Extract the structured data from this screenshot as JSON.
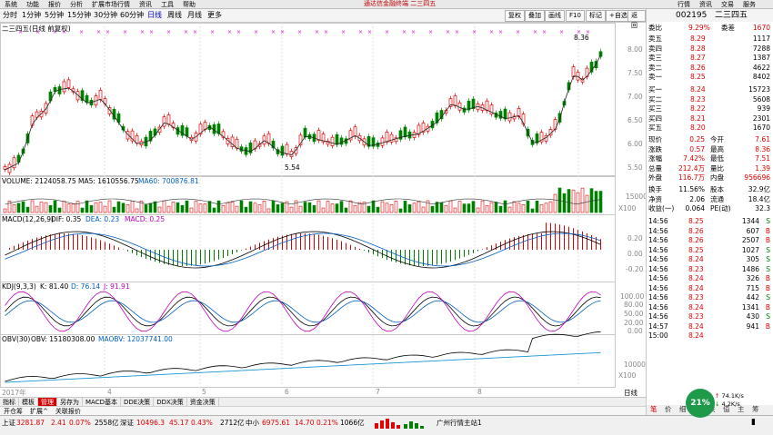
{
  "menu": {
    "left": [
      "系统",
      "功能",
      "报价",
      "分析",
      "扩展市场行情",
      "资讯",
      "工具",
      "帮助"
    ],
    "title": "通达信金融终端 二三四五",
    "right": [
      "行情",
      "资讯",
      "交易",
      "服务"
    ]
  },
  "period_tabs": [
    "分时",
    "1分钟",
    "5分钟",
    "15分钟",
    "30分钟",
    "60分钟",
    "日线",
    "周线",
    "月线",
    "更多"
  ],
  "active_period": "日线",
  "right_buttons": [
    "复权",
    "叠加",
    "画线",
    "F10",
    "标记",
    "+自选",
    "返回"
  ],
  "chart_title": "二三四五(日线 前复权)",
  "price_axis": [
    "8.00",
    "7.50",
    "7.00",
    "6.50",
    "6.00",
    "5.50"
  ],
  "annotations": {
    "high": "8.36",
    "low": "5.54"
  },
  "volume": {
    "label": "VOLUME: 2124058.75",
    "ma5": "MA5: 1610556.75",
    "ma60": "MA60: 700876.81",
    "axis": "15000",
    "unit": "X100"
  },
  "macd": {
    "label": "MACD(12,26,9)",
    "dif": "DIF: 0.35",
    "dea": "DEA: 0.23",
    "macd": "MACD: 0.25",
    "axis": [
      "0.20",
      "0.00",
      "-0.20"
    ]
  },
  "kdj": {
    "label": "KDJ(9,3,3)",
    "k": "K: 81.40",
    "d": "D: 76.14",
    "j": "J: 91.91",
    "axis": [
      "100.00",
      "80.00",
      "50.00",
      "20.00",
      "0.00"
    ]
  },
  "obv": {
    "label": "OBV(30)",
    "obv": "OBV: 15180308.00",
    "maobv": "MAOBV: 12037741.00",
    "axis": "10000",
    "unit": "X100"
  },
  "x_axis": [
    "2017年",
    "4",
    "5",
    "6",
    "7",
    "8"
  ],
  "bottom_tabs": [
    "指标",
    "模板",
    "管理",
    "另存为",
    "MACD基本",
    "DDE决策",
    "DDX决策",
    "资金决策"
  ],
  "bottom_tabs_active": "管理",
  "bottom_tabs2": [
    "开仓筹",
    "扩展^",
    "关联报价"
  ],
  "chart_right_tag": "日线",
  "stock": {
    "code": "002195",
    "name": "二三四五"
  },
  "weibi": {
    "label": "委比",
    "pct": "9.29%",
    "diff_label": "委差",
    "diff": "1670"
  },
  "asks": [
    {
      "label": "卖五",
      "price": "8.29",
      "vol": "1117"
    },
    {
      "label": "卖四",
      "price": "8.28",
      "vol": "7288"
    },
    {
      "label": "卖三",
      "price": "8.27",
      "vol": "1387"
    },
    {
      "label": "卖二",
      "price": "8.26",
      "vol": "4622"
    },
    {
      "label": "卖一",
      "price": "8.25",
      "vol": "8402"
    }
  ],
  "bids": [
    {
      "label": "买一",
      "price": "8.24",
      "vol": "15723"
    },
    {
      "label": "买二",
      "price": "8.23",
      "vol": "5608"
    },
    {
      "label": "买三",
      "price": "8.22",
      "vol": "939"
    },
    {
      "label": "买四",
      "price": "8.21",
      "vol": "2301"
    },
    {
      "label": "买五",
      "price": "8.20",
      "vol": "1670"
    }
  ],
  "quote": [
    {
      "l1": "现价",
      "v1": "0.25",
      "l2": "今开",
      "v2": "7.61"
    },
    {
      "l1": "涨跌",
      "v1": "0.57",
      "l2": "最高",
      "v2": "8.36"
    },
    {
      "l1": "涨幅",
      "v1": "7.42%",
      "l2": "最低",
      "v2": "7.51"
    },
    {
      "l1": "总量",
      "v1": "212.4万",
      "l2": "量比",
      "v2": "1.39"
    },
    {
      "l1": "外盘",
      "v1": "116.7万",
      "l2": "内盘",
      "v2": "956696"
    }
  ],
  "fund": [
    {
      "l1": "换手",
      "v1": "11.56%",
      "l2": "股本",
      "v2": "32.9亿"
    },
    {
      "l1": "净资",
      "v1": "2.06",
      "l2": "流通",
      "v2": "18.4亿"
    },
    {
      "l1": "收益(一)",
      "v1": "0.064",
      "l2": "PE(动)",
      "v2": "32.3"
    }
  ],
  "trades": [
    {
      "time": "14:56",
      "price": "8.25",
      "vol": "1344",
      "flag": "S"
    },
    {
      "time": "14:56",
      "price": "8.26",
      "vol": "607",
      "flag": "B"
    },
    {
      "time": "14:56",
      "price": "8.26",
      "vol": "2507",
      "flag": "B"
    },
    {
      "time": "14:56",
      "price": "8.25",
      "vol": "1027",
      "flag": "S"
    },
    {
      "time": "14:56",
      "price": "8.24",
      "vol": "305",
      "flag": "S"
    },
    {
      "time": "14:56",
      "price": "8.23",
      "vol": "1486",
      "flag": "S"
    },
    {
      "time": "14:56",
      "price": "8.24",
      "vol": "326",
      "flag": "B"
    },
    {
      "time": "14:56",
      "price": "8.24",
      "vol": "715",
      "flag": "B"
    },
    {
      "time": "14:56",
      "price": "8.23",
      "vol": "442",
      "flag": "S"
    },
    {
      "time": "14:56",
      "price": "8.24",
      "vol": "1341",
      "flag": "B"
    },
    {
      "time": "14:56",
      "price": "8.23",
      "vol": "430",
      "flag": "S"
    },
    {
      "time": "14:57",
      "price": "8.24",
      "vol": "941",
      "flag": "B"
    },
    {
      "time": "15:00",
      "price": "8.24",
      "vol": "",
      "flag": ""
    }
  ],
  "side_tabs": [
    "笔",
    "价",
    "细",
    "势",
    "联",
    "值",
    "主",
    "筹"
  ],
  "status": {
    "sh": {
      "label": "上证",
      "index": "3281.87",
      "chg": "2.41",
      "pct": "0.07%",
      "amt": "2558亿"
    },
    "sz": {
      "label": "深证",
      "index": "10496.3",
      "chg": "45.17",
      "pct": "0.43%",
      "amt": "2712亿"
    },
    "zx": {
      "label": "中小",
      "index": "6975.61",
      "chg": "14.70",
      "pct": "0.21%",
      "amt": "1066亿"
    },
    "site": "广州行情主站1"
  },
  "bubble": "21%",
  "netspeed": {
    "up": "74.1K/s",
    "down": "4.2K/s"
  }
}
